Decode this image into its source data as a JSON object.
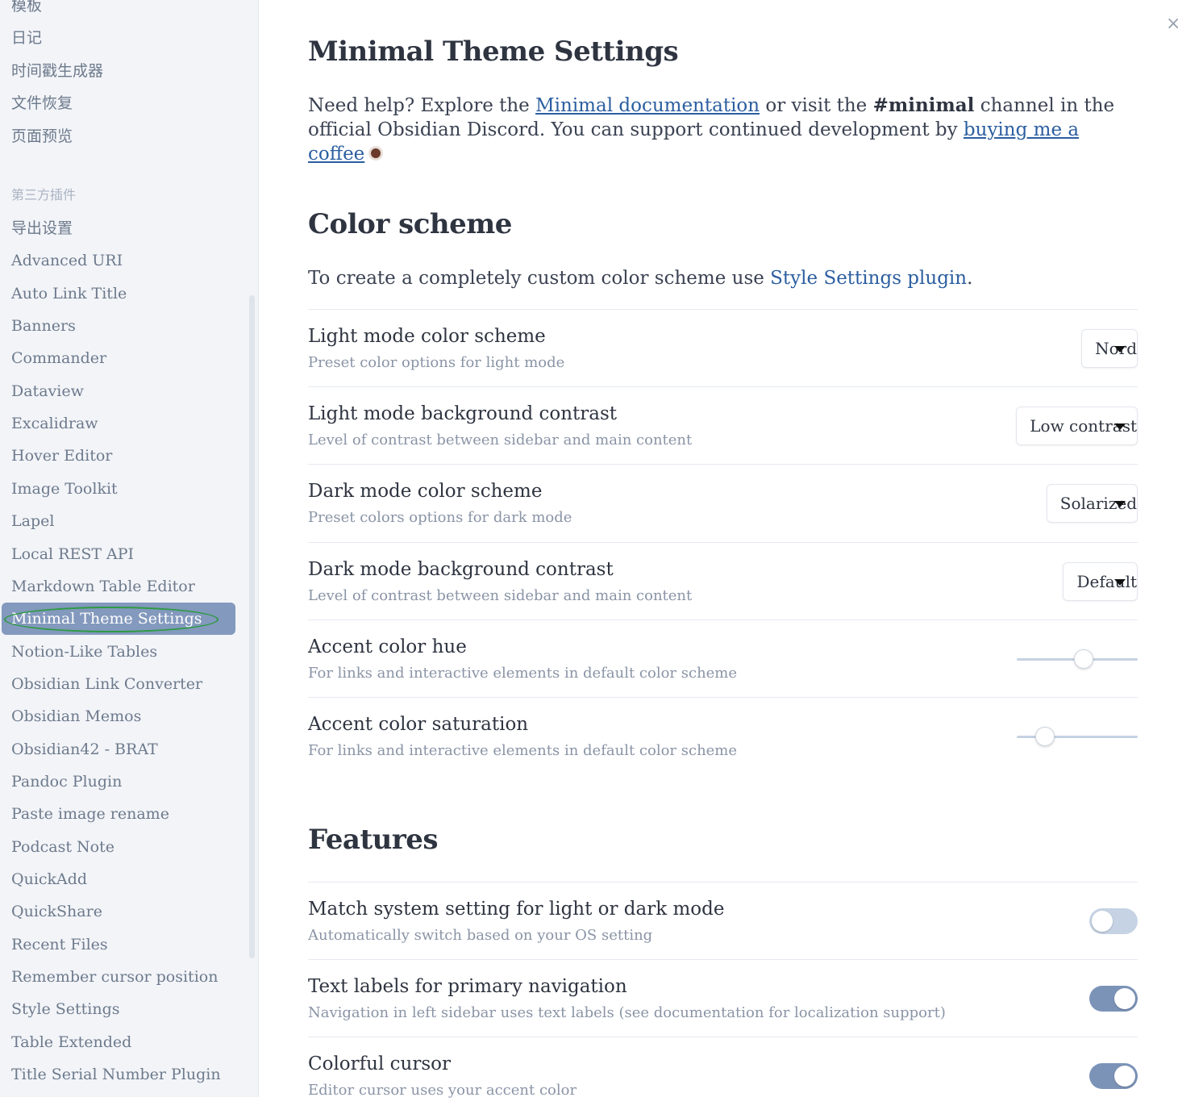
{
  "sidebar": {
    "core_items": [
      "模板",
      "日记",
      "时间戳生成器",
      "文件恢复",
      "页面预览"
    ],
    "group_title": "第三方插件",
    "plugin_items": [
      "导出设置",
      "Advanced URI",
      "Auto Link Title",
      "Banners",
      "Commander",
      "Dataview",
      "Excalidraw",
      "Hover Editor",
      "Image Toolkit",
      "Lapel",
      "Local REST API",
      "Markdown Table Editor",
      "Minimal Theme Settings",
      "Notion-Like Tables",
      "Obsidian Link Converter",
      "Obsidian Memos",
      "Obsidian42 - BRAT",
      "Pandoc Plugin",
      "Paste image rename",
      "Podcast Note",
      "QuickAdd",
      "QuickShare",
      "Recent Files",
      "Remember cursor position",
      "Style Settings",
      "Table Extended",
      "Title Serial Number Plugin"
    ],
    "active_item": "Minimal Theme Settings"
  },
  "main": {
    "close_icon": "×",
    "title": "Minimal Theme Settings",
    "intro": {
      "t1": "Need help? Explore the ",
      "link1": "Minimal documentation",
      "t2": " or visit the ",
      "bold": "#minimal",
      "t3": " channel in the official Obsidian Discord. You can support continued development by ",
      "link2": "buying me a coffee"
    },
    "color_scheme": {
      "heading": "Color scheme",
      "desc_text": "To create a completely custom color scheme use ",
      "desc_link": "Style Settings plugin",
      "desc_end": ".",
      "settings": [
        {
          "name": "Light mode color scheme",
          "desc": "Preset color options for light mode",
          "control": "dropdown",
          "value": "Nord"
        },
        {
          "name": "Light mode background contrast",
          "desc": "Level of contrast between sidebar and main content",
          "control": "dropdown",
          "value": "Low contrast"
        },
        {
          "name": "Dark mode color scheme",
          "desc": "Preset colors options for dark mode",
          "control": "dropdown",
          "value": "Solarized"
        },
        {
          "name": "Dark mode background contrast",
          "desc": "Level of contrast between sidebar and main content",
          "control": "dropdown",
          "value": "Default"
        },
        {
          "name": "Accent color hue",
          "desc": "For links and interactive elements in default color scheme",
          "control": "slider",
          "value": 0.55
        },
        {
          "name": "Accent color saturation",
          "desc": "For links and interactive elements in default color scheme",
          "control": "slider",
          "value": 0.23
        }
      ]
    },
    "features": {
      "heading": "Features",
      "settings": [
        {
          "name": "Match system setting for light or dark mode",
          "desc": "Automatically switch based on your OS setting",
          "control": "toggle",
          "on": false
        },
        {
          "name": "Text labels for primary navigation",
          "desc": "Navigation in left sidebar uses text labels (see documentation for localization support)",
          "control": "toggle",
          "on": true
        },
        {
          "name": "Colorful cursor",
          "desc": "Editor cursor uses your accent color",
          "control": "toggle",
          "on": true
        }
      ]
    }
  },
  "colors": {
    "accent": "#7c93b8",
    "link": "#2b5ea0",
    "active_nav": "#8399bd",
    "highlight_ring": "#2e9a44"
  }
}
